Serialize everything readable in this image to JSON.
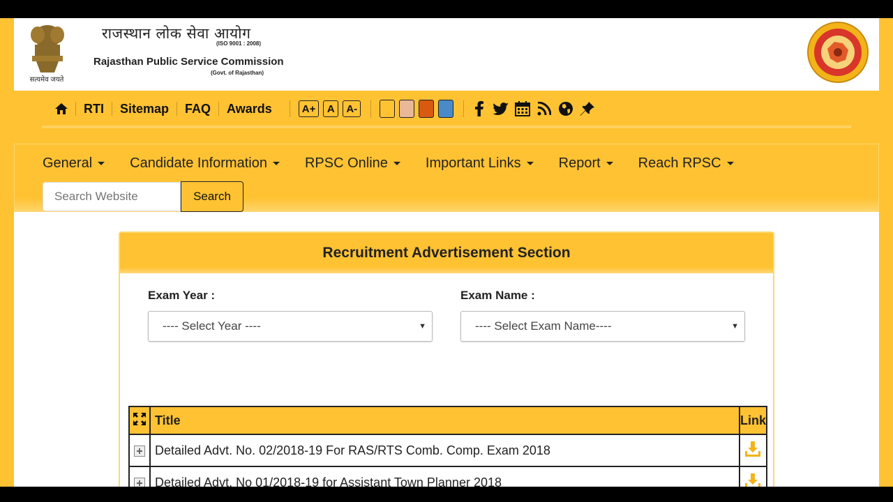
{
  "header": {
    "title_hindi": "राजस्थान लोक सेवा आयोग",
    "iso": "(ISO 9001 : 2008)",
    "title_english": "Rajasthan Public Service Commission",
    "govt": "(Govt. of Rajasthan)",
    "motto": "सत्यमेव जयते"
  },
  "utility": {
    "links": [
      "RTI",
      "Sitemap",
      "FAQ",
      "Awards"
    ],
    "font_sizes": [
      "A+",
      "A",
      "A-"
    ],
    "theme_colors": [
      "#ffc233",
      "#e8b898",
      "#d85a10",
      "#4a8ac8"
    ],
    "social_icons": [
      "facebook-icon",
      "twitter-icon",
      "calendar-icon",
      "rss-icon",
      "globe-icon",
      "pin-icon"
    ]
  },
  "nav": {
    "items": [
      "General",
      "Candidate Information",
      "RPSC Online",
      "Important Links",
      "Report",
      "Reach RPSC"
    ],
    "search_placeholder": "Search Website",
    "search_button": "Search"
  },
  "section": {
    "title": "Recruitment Advertisement Section",
    "year_label": "Exam Year :",
    "year_value": "---- Select Year ----",
    "exam_label": "Exam Name :",
    "exam_value": "---- Select Exam Name----"
  },
  "table": {
    "headers": [
      "Title",
      "Link"
    ],
    "rows": [
      "Detailed Advt. No. 02/2018-19 For RAS/RTS Comb. Comp. Exam 2018",
      "Detailed Advt. No 01/2018-19 for Assistant Town Planner 2018"
    ]
  },
  "colors": {
    "primary": "#ffc233",
    "text": "#222222"
  }
}
